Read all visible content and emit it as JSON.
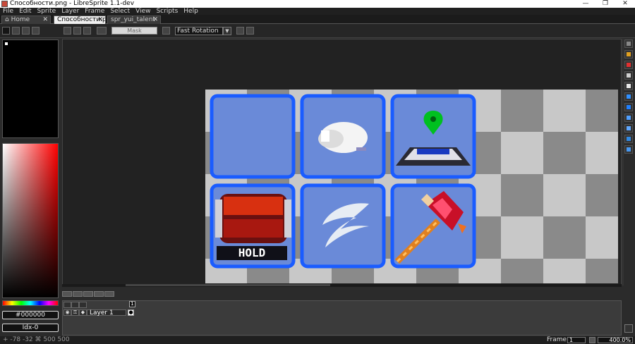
{
  "window": {
    "title": "Способности.png - LibreSprite 1.1-dev",
    "controls": [
      "—",
      "❐",
      "✕"
    ]
  },
  "menu": [
    "File",
    "Edit",
    "Sprite",
    "Layer",
    "Frame",
    "Select",
    "View",
    "Scripts",
    "Help"
  ],
  "tabs": [
    {
      "label": "Home",
      "active": false
    },
    {
      "label": "Способности.p",
      "active": true
    },
    {
      "label": "spr_yui_talent",
      "active": false
    }
  ],
  "context_bar": {
    "transparent_color_label": "Mask",
    "rotation_algorithm": "Fast Rotation"
  },
  "color_panel": {
    "hex_value": "#000000",
    "index_value": "Idx-0"
  },
  "timeline": {
    "frame_header": "1",
    "layer_name": "Layer 1"
  },
  "status": {
    "coords": "+ -78 -32  ⌘ 500 500",
    "frame_label": "Frame:",
    "frame_value": "1",
    "zoom_value": "400.0%"
  },
  "colors": {
    "tile_border": "#1a5cff",
    "tile_fill": "#6a8ad8",
    "checker_light": "#c8c8c8",
    "checker_dark": "#8a8a8a"
  },
  "sprite_icons": [
    "empty-slot",
    "glove-icon",
    "location-pin-icon",
    "hold-barrel-icon",
    "wind-gust-icon",
    "fire-axe-icon"
  ],
  "hold_text": "HOLD"
}
